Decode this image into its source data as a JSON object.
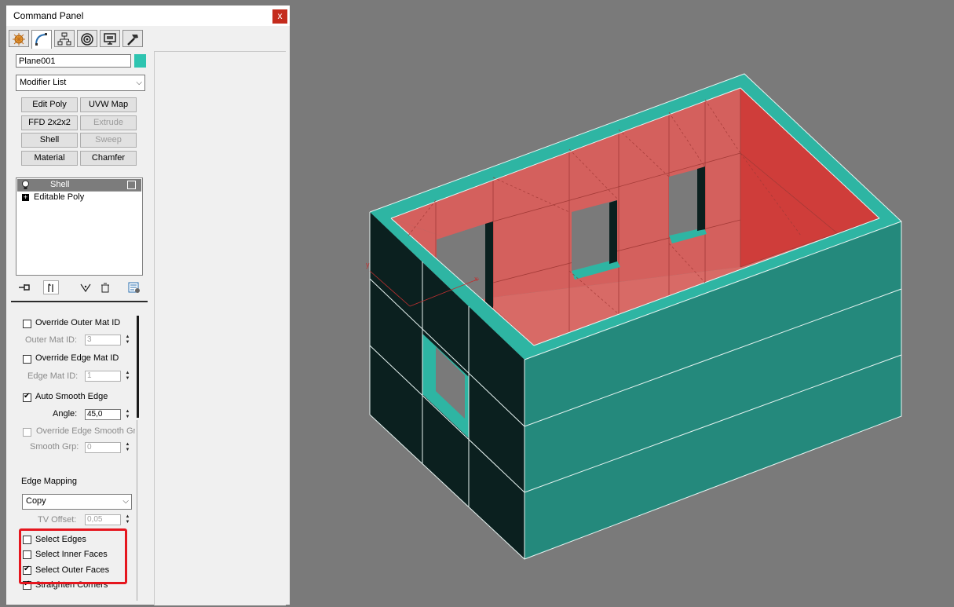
{
  "window": {
    "title": "Command Panel",
    "close_label": "x"
  },
  "tabs": [
    {
      "icon": "create-icon"
    },
    {
      "icon": "modify-icon",
      "active": true
    },
    {
      "icon": "hierarchy-icon"
    },
    {
      "icon": "motion-icon"
    },
    {
      "icon": "display-icon"
    },
    {
      "icon": "utilities-icon"
    }
  ],
  "object": {
    "name": "Plane001",
    "color": "#2ec4b0"
  },
  "modifier_list": {
    "label": "Modifier List"
  },
  "modifier_buttons": [
    {
      "label": "Edit Poly",
      "enabled": true
    },
    {
      "label": "UVW Map",
      "enabled": true
    },
    {
      "label": "FFD 2x2x2",
      "enabled": true
    },
    {
      "label": "Extrude",
      "enabled": false
    },
    {
      "label": "Shell",
      "enabled": true
    },
    {
      "label": "Sweep",
      "enabled": false
    },
    {
      "label": "Material",
      "enabled": true
    },
    {
      "label": "Chamfer",
      "enabled": true
    }
  ],
  "stack": [
    {
      "label": "Shell",
      "selected": true
    },
    {
      "label": "Editable Poly",
      "selected": false
    }
  ],
  "params": {
    "override_outer_mat_id": {
      "label": "Override Outer Mat ID",
      "checked": false
    },
    "outer_mat_id": {
      "label": "Outer Mat ID:",
      "value": "3"
    },
    "override_edge_mat_id": {
      "label": "Override Edge Mat ID",
      "checked": false
    },
    "edge_mat_id": {
      "label": "Edge Mat ID:",
      "value": "1"
    },
    "auto_smooth_edge": {
      "label": "Auto Smooth Edge",
      "checked": true
    },
    "angle": {
      "label": "Angle:",
      "value": "45,0"
    },
    "override_edge_smooth_grp": {
      "label": "Override Edge Smooth Grp",
      "checked": false
    },
    "smooth_grp": {
      "label": "Smooth Grp:",
      "value": "0"
    },
    "edge_mapping": {
      "label": "Edge Mapping",
      "value": "Copy"
    },
    "tv_offset": {
      "label": "TV Offset:",
      "value": "0,05"
    },
    "select_edges": {
      "label": "Select Edges",
      "checked": false
    },
    "select_inner_faces": {
      "label": "Select Inner Faces",
      "checked": false
    },
    "select_outer_faces": {
      "label": "Select Outer Faces",
      "checked": true
    },
    "straighten_corners": {
      "label": "Straighten Corners",
      "checked": true
    }
  },
  "colors": {
    "highlight": "#e5161e",
    "wall_outer": "#24897c",
    "wall_rim": "#2eb5a3",
    "wall_inner": "#d4605d",
    "wall_dark": "#0b201f",
    "viewport_bg": "#7a7a7a"
  }
}
